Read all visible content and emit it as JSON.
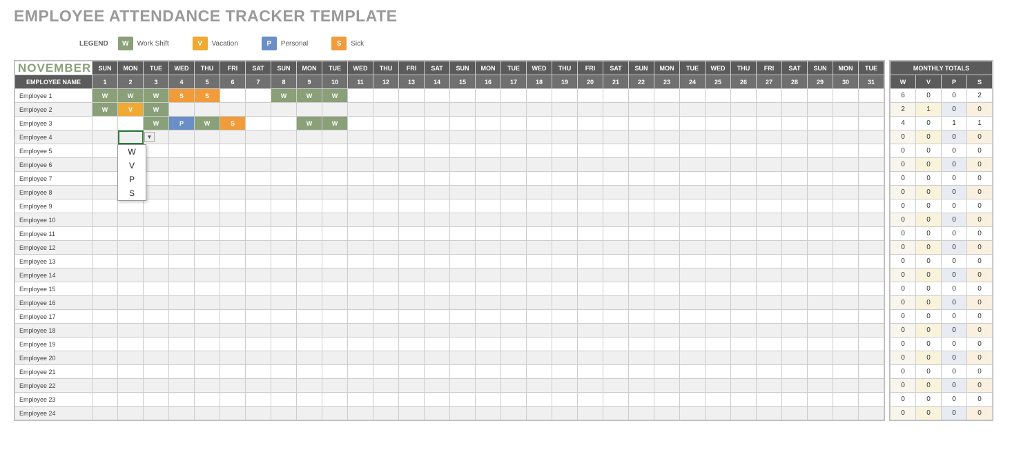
{
  "title": "EMPLOYEE ATTENDANCE TRACKER TEMPLATE",
  "legend": {
    "label": "LEGEND",
    "items": [
      {
        "code": "W",
        "text": "Work Shift",
        "cls": "lg-w"
      },
      {
        "code": "V",
        "text": "Vacation",
        "cls": "lg-v"
      },
      {
        "code": "P",
        "text": "Personal",
        "cls": "lg-p"
      },
      {
        "code": "S",
        "text": "Sick",
        "cls": "lg-s"
      }
    ]
  },
  "month": "NOVEMBER",
  "employee_header": "EMPLOYEE NAME",
  "monthly_totals_header": "MONTHLY TOTALS",
  "day_headers": [
    "SUN",
    "MON",
    "TUE",
    "WED",
    "THU",
    "FRI",
    "SAT",
    "SUN",
    "MON",
    "TUE",
    "WED",
    "THU",
    "FRI",
    "SAT",
    "SUN",
    "MON",
    "TUE",
    "WED",
    "THU",
    "FRI",
    "SAT",
    "SUN",
    "MON",
    "TUE",
    "WED",
    "THU",
    "FRI",
    "SAT",
    "SUN",
    "MON",
    "TUE"
  ],
  "day_numbers": [
    1,
    2,
    3,
    4,
    5,
    6,
    7,
    8,
    9,
    10,
    11,
    12,
    13,
    14,
    15,
    16,
    17,
    18,
    19,
    20,
    21,
    22,
    23,
    24,
    25,
    26,
    27,
    28,
    29,
    30,
    31
  ],
  "totals_cols": [
    "W",
    "V",
    "P",
    "S"
  ],
  "dropdown_options": [
    "W",
    "V",
    "P",
    "S"
  ],
  "active_cell": {
    "row": 3,
    "col": 1
  },
  "employees": [
    {
      "name": "Employee 1",
      "days": [
        "W",
        "W",
        "W",
        "S",
        "S",
        "",
        "",
        "W",
        "W",
        "W",
        "",
        "",
        "",
        "",
        "",
        "",
        "",
        "",
        "",
        "",
        "",
        "",
        "",
        "",
        "",
        "",
        "",
        "",
        "",
        "",
        ""
      ],
      "totals": [
        6,
        0,
        0,
        2
      ]
    },
    {
      "name": "Employee 2",
      "days": [
        "W",
        "V",
        "W",
        "",
        "",
        "",
        "",
        "",
        "",
        "",
        "",
        "",
        "",
        "",
        "",
        "",
        "",
        "",
        "",
        "",
        "",
        "",
        "",
        "",
        "",
        "",
        "",
        "",
        "",
        "",
        ""
      ],
      "totals": [
        2,
        1,
        0,
        0
      ]
    },
    {
      "name": "Employee 3",
      "days": [
        "",
        "",
        "W",
        "P",
        "W",
        "S",
        "",
        "",
        "W",
        "W",
        "",
        "",
        "",
        "",
        "",
        "",
        "",
        "",
        "",
        "",
        "",
        "",
        "",
        "",
        "",
        "",
        "",
        "",
        "",
        "",
        ""
      ],
      "totals": [
        4,
        0,
        1,
        1
      ]
    },
    {
      "name": "Employee 4",
      "days": [
        "",
        "",
        "",
        "",
        "",
        "",
        "",
        "",
        "",
        "",
        "",
        "",
        "",
        "",
        "",
        "",
        "",
        "",
        "",
        "",
        "",
        "",
        "",
        "",
        "",
        "",
        "",
        "",
        "",
        "",
        ""
      ],
      "totals": [
        0,
        0,
        0,
        0
      ]
    },
    {
      "name": "Employee 5",
      "days": [
        "",
        "",
        "",
        "",
        "",
        "",
        "",
        "",
        "",
        "",
        "",
        "",
        "",
        "",
        "",
        "",
        "",
        "",
        "",
        "",
        "",
        "",
        "",
        "",
        "",
        "",
        "",
        "",
        "",
        "",
        ""
      ],
      "totals": [
        0,
        0,
        0,
        0
      ]
    },
    {
      "name": "Employee 6",
      "days": [
        "",
        "",
        "",
        "",
        "",
        "",
        "",
        "",
        "",
        "",
        "",
        "",
        "",
        "",
        "",
        "",
        "",
        "",
        "",
        "",
        "",
        "",
        "",
        "",
        "",
        "",
        "",
        "",
        "",
        "",
        ""
      ],
      "totals": [
        0,
        0,
        0,
        0
      ]
    },
    {
      "name": "Employee 7",
      "days": [
        "",
        "",
        "",
        "",
        "",
        "",
        "",
        "",
        "",
        "",
        "",
        "",
        "",
        "",
        "",
        "",
        "",
        "",
        "",
        "",
        "",
        "",
        "",
        "",
        "",
        "",
        "",
        "",
        "",
        "",
        ""
      ],
      "totals": [
        0,
        0,
        0,
        0
      ]
    },
    {
      "name": "Employee 8",
      "days": [
        "",
        "",
        "",
        "",
        "",
        "",
        "",
        "",
        "",
        "",
        "",
        "",
        "",
        "",
        "",
        "",
        "",
        "",
        "",
        "",
        "",
        "",
        "",
        "",
        "",
        "",
        "",
        "",
        "",
        "",
        ""
      ],
      "totals": [
        0,
        0,
        0,
        0
      ]
    },
    {
      "name": "Employee 9",
      "days": [
        "",
        "",
        "",
        "",
        "",
        "",
        "",
        "",
        "",
        "",
        "",
        "",
        "",
        "",
        "",
        "",
        "",
        "",
        "",
        "",
        "",
        "",
        "",
        "",
        "",
        "",
        "",
        "",
        "",
        "",
        ""
      ],
      "totals": [
        0,
        0,
        0,
        0
      ]
    },
    {
      "name": "Employee 10",
      "days": [
        "",
        "",
        "",
        "",
        "",
        "",
        "",
        "",
        "",
        "",
        "",
        "",
        "",
        "",
        "",
        "",
        "",
        "",
        "",
        "",
        "",
        "",
        "",
        "",
        "",
        "",
        "",
        "",
        "",
        "",
        ""
      ],
      "totals": [
        0,
        0,
        0,
        0
      ]
    },
    {
      "name": "Employee 11",
      "days": [
        "",
        "",
        "",
        "",
        "",
        "",
        "",
        "",
        "",
        "",
        "",
        "",
        "",
        "",
        "",
        "",
        "",
        "",
        "",
        "",
        "",
        "",
        "",
        "",
        "",
        "",
        "",
        "",
        "",
        "",
        ""
      ],
      "totals": [
        0,
        0,
        0,
        0
      ]
    },
    {
      "name": "Employee 12",
      "days": [
        "",
        "",
        "",
        "",
        "",
        "",
        "",
        "",
        "",
        "",
        "",
        "",
        "",
        "",
        "",
        "",
        "",
        "",
        "",
        "",
        "",
        "",
        "",
        "",
        "",
        "",
        "",
        "",
        "",
        "",
        ""
      ],
      "totals": [
        0,
        0,
        0,
        0
      ]
    },
    {
      "name": "Employee 13",
      "days": [
        "",
        "",
        "",
        "",
        "",
        "",
        "",
        "",
        "",
        "",
        "",
        "",
        "",
        "",
        "",
        "",
        "",
        "",
        "",
        "",
        "",
        "",
        "",
        "",
        "",
        "",
        "",
        "",
        "",
        "",
        ""
      ],
      "totals": [
        0,
        0,
        0,
        0
      ]
    },
    {
      "name": "Employee 14",
      "days": [
        "",
        "",
        "",
        "",
        "",
        "",
        "",
        "",
        "",
        "",
        "",
        "",
        "",
        "",
        "",
        "",
        "",
        "",
        "",
        "",
        "",
        "",
        "",
        "",
        "",
        "",
        "",
        "",
        "",
        "",
        ""
      ],
      "totals": [
        0,
        0,
        0,
        0
      ]
    },
    {
      "name": "Employee 15",
      "days": [
        "",
        "",
        "",
        "",
        "",
        "",
        "",
        "",
        "",
        "",
        "",
        "",
        "",
        "",
        "",
        "",
        "",
        "",
        "",
        "",
        "",
        "",
        "",
        "",
        "",
        "",
        "",
        "",
        "",
        "",
        ""
      ],
      "totals": [
        0,
        0,
        0,
        0
      ]
    },
    {
      "name": "Employee 16",
      "days": [
        "",
        "",
        "",
        "",
        "",
        "",
        "",
        "",
        "",
        "",
        "",
        "",
        "",
        "",
        "",
        "",
        "",
        "",
        "",
        "",
        "",
        "",
        "",
        "",
        "",
        "",
        "",
        "",
        "",
        "",
        ""
      ],
      "totals": [
        0,
        0,
        0,
        0
      ]
    },
    {
      "name": "Employee 17",
      "days": [
        "",
        "",
        "",
        "",
        "",
        "",
        "",
        "",
        "",
        "",
        "",
        "",
        "",
        "",
        "",
        "",
        "",
        "",
        "",
        "",
        "",
        "",
        "",
        "",
        "",
        "",
        "",
        "",
        "",
        "",
        ""
      ],
      "totals": [
        0,
        0,
        0,
        0
      ]
    },
    {
      "name": "Employee 18",
      "days": [
        "",
        "",
        "",
        "",
        "",
        "",
        "",
        "",
        "",
        "",
        "",
        "",
        "",
        "",
        "",
        "",
        "",
        "",
        "",
        "",
        "",
        "",
        "",
        "",
        "",
        "",
        "",
        "",
        "",
        "",
        ""
      ],
      "totals": [
        0,
        0,
        0,
        0
      ]
    },
    {
      "name": "Employee 19",
      "days": [
        "",
        "",
        "",
        "",
        "",
        "",
        "",
        "",
        "",
        "",
        "",
        "",
        "",
        "",
        "",
        "",
        "",
        "",
        "",
        "",
        "",
        "",
        "",
        "",
        "",
        "",
        "",
        "",
        "",
        "",
        ""
      ],
      "totals": [
        0,
        0,
        0,
        0
      ]
    },
    {
      "name": "Employee 20",
      "days": [
        "",
        "",
        "",
        "",
        "",
        "",
        "",
        "",
        "",
        "",
        "",
        "",
        "",
        "",
        "",
        "",
        "",
        "",
        "",
        "",
        "",
        "",
        "",
        "",
        "",
        "",
        "",
        "",
        "",
        "",
        ""
      ],
      "totals": [
        0,
        0,
        0,
        0
      ]
    },
    {
      "name": "Employee 21",
      "days": [
        "",
        "",
        "",
        "",
        "",
        "",
        "",
        "",
        "",
        "",
        "",
        "",
        "",
        "",
        "",
        "",
        "",
        "",
        "",
        "",
        "",
        "",
        "",
        "",
        "",
        "",
        "",
        "",
        "",
        "",
        ""
      ],
      "totals": [
        0,
        0,
        0,
        0
      ]
    },
    {
      "name": "Employee 22",
      "days": [
        "",
        "",
        "",
        "",
        "",
        "",
        "",
        "",
        "",
        "",
        "",
        "",
        "",
        "",
        "",
        "",
        "",
        "",
        "",
        "",
        "",
        "",
        "",
        "",
        "",
        "",
        "",
        "",
        "",
        "",
        ""
      ],
      "totals": [
        0,
        0,
        0,
        0
      ]
    },
    {
      "name": "Employee 23",
      "days": [
        "",
        "",
        "",
        "",
        "",
        "",
        "",
        "",
        "",
        "",
        "",
        "",
        "",
        "",
        "",
        "",
        "",
        "",
        "",
        "",
        "",
        "",
        "",
        "",
        "",
        "",
        "",
        "",
        "",
        "",
        ""
      ],
      "totals": [
        0,
        0,
        0,
        0
      ]
    },
    {
      "name": "Employee 24",
      "days": [
        "",
        "",
        "",
        "",
        "",
        "",
        "",
        "",
        "",
        "",
        "",
        "",
        "",
        "",
        "",
        "",
        "",
        "",
        "",
        "",
        "",
        "",
        "",
        "",
        "",
        "",
        "",
        "",
        "",
        "",
        ""
      ],
      "totals": [
        0,
        0,
        0,
        0
      ]
    }
  ]
}
